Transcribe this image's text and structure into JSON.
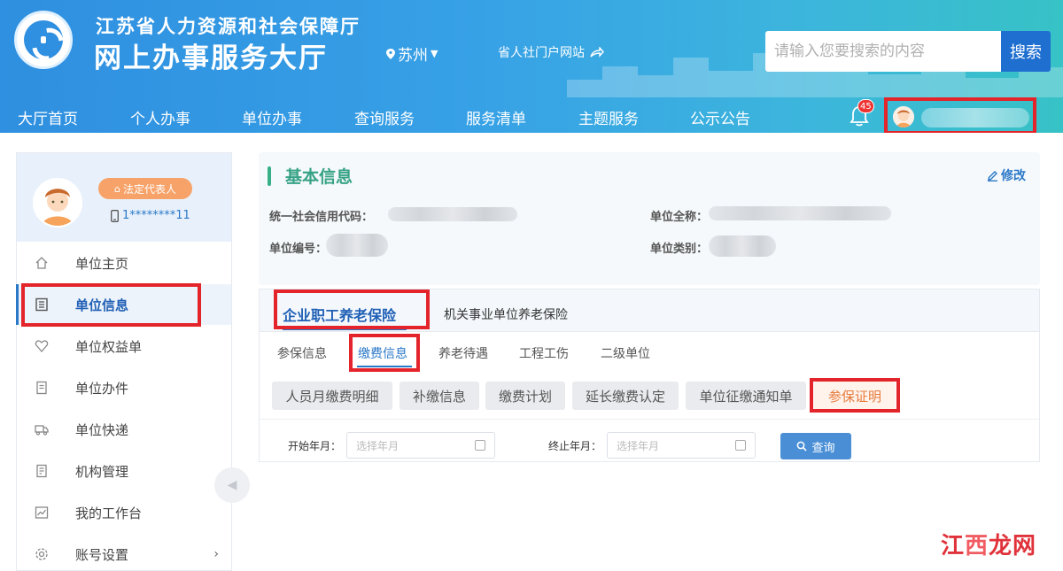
{
  "header": {
    "org_name": "江苏省人力资源和社会保障厅",
    "hall_name": "网上办事服务大厅",
    "city": "苏州",
    "portal_link": "省人社门户网站",
    "search": {
      "placeholder": "请输入您要搜索的内容",
      "button": "搜索"
    },
    "notification_count": "45",
    "nav": [
      "大厅首页",
      "个人办事",
      "单位办事",
      "查询服务",
      "服务清单",
      "主题服务",
      "公示公告"
    ]
  },
  "sidebar": {
    "role_badge": "法定代表人",
    "phone": "1********11",
    "items": [
      {
        "label": "单位主页",
        "icon": "home-icon"
      },
      {
        "label": "单位信息",
        "icon": "document-list-icon"
      },
      {
        "label": "单位权益单",
        "icon": "heart-shield-icon"
      },
      {
        "label": "单位办件",
        "icon": "file-icon"
      },
      {
        "label": "单位快递",
        "icon": "truck-icon"
      },
      {
        "label": "机构管理",
        "icon": "building-icon"
      },
      {
        "label": "我的工作台",
        "icon": "chart-icon"
      },
      {
        "label": "账号设置",
        "icon": "gear-icon"
      }
    ]
  },
  "basic_info": {
    "title": "基本信息",
    "edit_label": "修改",
    "fields": {
      "credit_code_label": "统一社会信用代码：",
      "full_name_label": "单位全称：",
      "unit_no_label": "单位编号：",
      "category_label": "单位类别："
    }
  },
  "insurance_tabs": {
    "main": [
      "企业职工养老保险",
      "机关事业单位养老保险"
    ],
    "sub": [
      "参保信息",
      "缴费信息",
      "养老待遇",
      "工程工伤",
      "二级单位"
    ],
    "chips": [
      "人员月缴费明细",
      "补缴信息",
      "缴费计划",
      "延长缴费认定",
      "单位征缴通知单",
      "参保证明"
    ]
  },
  "filters": {
    "start_label": "开始年月：",
    "end_label": "终止年月：",
    "date_placeholder": "选择年月",
    "query_button": "查询"
  },
  "watermark": {
    "part1": "江",
    "part2": "西",
    "part3": "龙网"
  },
  "colors": {
    "highlight": "#e3252b",
    "primary": "#2a78c8",
    "section_accent": "#37b088",
    "active_chip": "#e77a3a"
  }
}
